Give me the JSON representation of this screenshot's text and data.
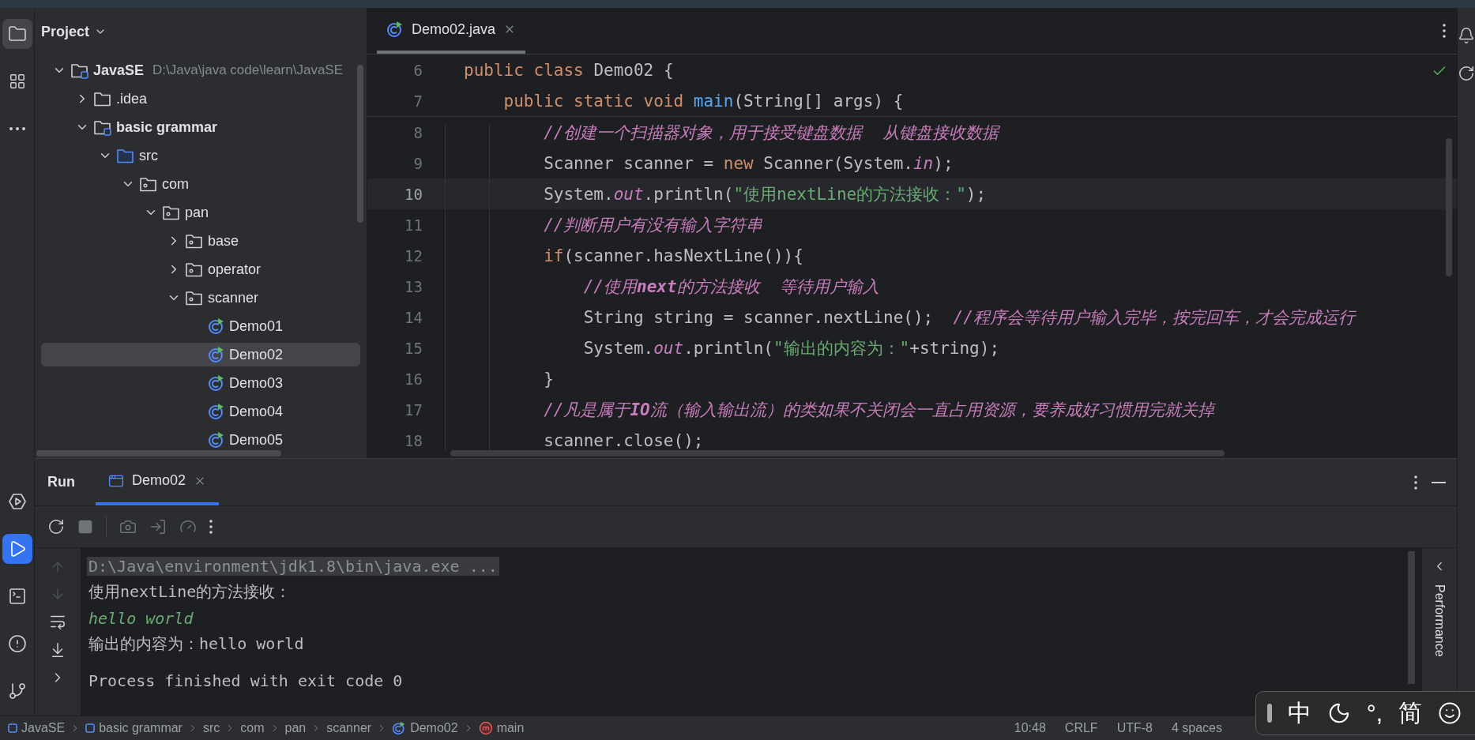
{
  "left_toolbar": {
    "top": [
      {
        "kind": "project",
        "selected": true
      },
      {
        "kind": "structure",
        "selected": false
      },
      {
        "kind": "more",
        "selected": false
      }
    ],
    "bottom": [
      {
        "kind": "services",
        "selected": false
      },
      {
        "kind": "run",
        "selected": true
      },
      {
        "kind": "terminal",
        "selected": false
      },
      {
        "kind": "problems",
        "selected": false
      },
      {
        "kind": "git",
        "selected": false
      }
    ]
  },
  "project": {
    "title": "Project",
    "tree": [
      {
        "label": "JavaSE",
        "hint": "D:\\Java\\java code\\learn\\JavaSE",
        "kind": "module",
        "expanded": true,
        "selected": false,
        "children": [
          {
            "label": ".idea",
            "kind": "folder",
            "expanded": false,
            "selected": false
          },
          {
            "label": "basic grammar",
            "kind": "module",
            "expanded": true,
            "selected": false,
            "children": [
              {
                "label": "src",
                "kind": "source",
                "expanded": true,
                "selected": false,
                "children": [
                  {
                    "label": "com",
                    "kind": "package",
                    "expanded": true,
                    "selected": false,
                    "children": [
                      {
                        "label": "pan",
                        "kind": "package",
                        "expanded": true,
                        "selected": false,
                        "children": [
                          {
                            "label": "base",
                            "kind": "package",
                            "expanded": false,
                            "selected": false
                          },
                          {
                            "label": "operator",
                            "kind": "package",
                            "expanded": false,
                            "selected": false
                          },
                          {
                            "label": "scanner",
                            "kind": "package",
                            "expanded": true,
                            "selected": false,
                            "children": [
                              {
                                "label": "Demo01",
                                "kind": "class",
                                "selected": false
                              },
                              {
                                "label": "Demo02",
                                "kind": "class",
                                "selected": true
                              },
                              {
                                "label": "Demo03",
                                "kind": "class",
                                "selected": false
                              },
                              {
                                "label": "Demo04",
                                "kind": "class",
                                "selected": false
                              },
                              {
                                "label": "Demo05",
                                "kind": "class",
                                "selected": false
                              }
                            ]
                          }
                        ]
                      }
                    ]
                  }
                ]
              }
            ]
          }
        ]
      }
    ]
  },
  "editor": {
    "tabs": [
      {
        "label": "Demo02.java",
        "selected": true
      }
    ],
    "sticky_lines": [
      {
        "number": "6",
        "tokens": [
          {
            "kind": "keyword",
            "text": "public class "
          },
          {
            "kind": "plain",
            "text": "Demo02 {"
          }
        ]
      },
      {
        "number": "7",
        "tokens": [
          {
            "kind": "keyword",
            "text": "    public static void "
          },
          {
            "kind": "method",
            "text": "main"
          },
          {
            "kind": "plain",
            "text": "(String[] args) {"
          }
        ]
      }
    ],
    "lines": [
      {
        "number": "8",
        "selected": false,
        "tokens": [
          {
            "kind": "comment",
            "text": "        //创建一个扫描器对象，用于接受键盘数据  从键盘接收数据"
          }
        ]
      },
      {
        "number": "9",
        "selected": false,
        "tokens": [
          {
            "kind": "plain",
            "text": "        Scanner scanner = "
          },
          {
            "kind": "keyword",
            "text": "new"
          },
          {
            "kind": "plain",
            "text": " Scanner(System."
          },
          {
            "kind": "field",
            "text": "in"
          },
          {
            "kind": "plain",
            "text": ");"
          }
        ]
      },
      {
        "number": "10",
        "selected": true,
        "tokens": [
          {
            "kind": "plain",
            "text": "        System."
          },
          {
            "kind": "field",
            "text": "out"
          },
          {
            "kind": "plain",
            "text": ".println("
          },
          {
            "kind": "string",
            "text": "\"使用nextLine的方法接收：\""
          },
          {
            "kind": "plain",
            "text": ");"
          }
        ]
      },
      {
        "number": "11",
        "selected": false,
        "tokens": [
          {
            "kind": "comment",
            "text": "        //判断用户有没有输入字符串"
          }
        ]
      },
      {
        "number": "12",
        "selected": false,
        "tokens": [
          {
            "kind": "keyword",
            "text": "        if"
          },
          {
            "kind": "plain",
            "text": "(scanner.hasNextLine()){"
          }
        ]
      },
      {
        "number": "13",
        "selected": false,
        "tokens": [
          {
            "kind": "comment",
            "text": "            //使用**next**的方法接收  等待用户输入"
          }
        ]
      },
      {
        "number": "14",
        "selected": false,
        "tokens": [
          {
            "kind": "plain",
            "text": "            String string = scanner.nextLine();  "
          },
          {
            "kind": "comment",
            "text": "//程序会等待用户输入完毕，按完回车，才会完成运行"
          }
        ]
      },
      {
        "number": "15",
        "selected": false,
        "tokens": [
          {
            "kind": "plain",
            "text": "            System."
          },
          {
            "kind": "field",
            "text": "out"
          },
          {
            "kind": "plain",
            "text": ".println("
          },
          {
            "kind": "string",
            "text": "\"输出的内容为：\""
          },
          {
            "kind": "plain",
            "text": "+string);"
          }
        ]
      },
      {
        "number": "16",
        "selected": false,
        "tokens": [
          {
            "kind": "plain",
            "text": "        }"
          }
        ]
      },
      {
        "number": "17",
        "selected": false,
        "tokens": [
          {
            "kind": "comment",
            "text": "        //凡是属于**IO**流（输入输出流）的类如果不关闭会一直占用资源，要养成好习惯用完就关掉"
          }
        ]
      },
      {
        "number": "18",
        "selected": false,
        "tokens": [
          {
            "kind": "plain",
            "text": "        scanner.close();"
          }
        ]
      }
    ]
  },
  "run_panel": {
    "title": "Run",
    "tabs": [
      {
        "label": "Demo02",
        "selected": true
      }
    ],
    "console": [
      {
        "kind": "command",
        "text": "D:\\Java\\environment\\jdk1.8\\bin\\java.exe ..."
      },
      {
        "kind": "output",
        "text": "使用nextLine的方法接收："
      },
      {
        "kind": "input",
        "text": "hello world"
      },
      {
        "kind": "output",
        "text": "输出的内容为：hello world"
      },
      {
        "kind": "status",
        "text": "Process finished with exit code 0"
      }
    ],
    "side_tab": "Performance"
  },
  "status_bar": {
    "breadcrumbs": [
      {
        "label": "JavaSE",
        "kind": "module"
      },
      {
        "label": "basic grammar",
        "kind": "module"
      },
      {
        "label": "src",
        "kind": "folder"
      },
      {
        "label": "com",
        "kind": "folder"
      },
      {
        "label": "pan",
        "kind": "folder"
      },
      {
        "label": "scanner",
        "kind": "folder"
      },
      {
        "label": "Demo02",
        "kind": "class"
      },
      {
        "label": "main",
        "kind": "method"
      }
    ],
    "items": [
      "10:48",
      "CRLF",
      "UTF-8",
      "4 spaces"
    ]
  },
  "ime_toolbar": [
    {
      "kind": "text",
      "text": "中"
    },
    {
      "kind": "moon"
    },
    {
      "kind": "text",
      "text": "°,"
    },
    {
      "kind": "text",
      "text": "简"
    },
    {
      "kind": "smiley"
    }
  ]
}
